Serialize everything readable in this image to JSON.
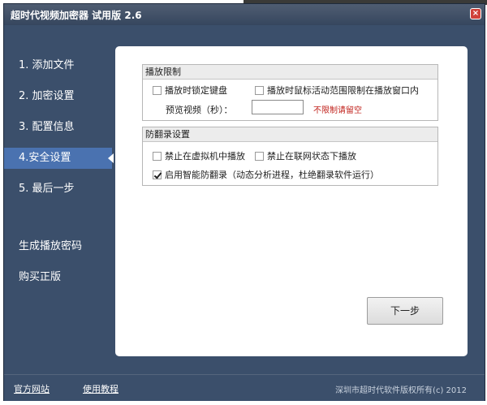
{
  "window": {
    "title": "超时代视频加密器 试用版 2.6",
    "close_icon_glyph": "×"
  },
  "nav": {
    "items": [
      {
        "label": "1. 添加文件",
        "active": false
      },
      {
        "label": "2. 加密设置",
        "active": false
      },
      {
        "label": "3. 配置信息",
        "active": false
      },
      {
        "label": "4.安全设置",
        "active": true
      },
      {
        "label": "5. 最后一步",
        "active": false
      }
    ],
    "generate_password": "生成播放密码",
    "buy": "购买正版"
  },
  "playback_limit": {
    "header": "播放限制",
    "lock_keyboard": {
      "label": "播放时锁定键盘",
      "checked": false
    },
    "restrict_mouse": {
      "label": "播放时鼠标活动范围限制在播放窗口内",
      "checked": false
    },
    "preview_label": "预览视频（秒）：",
    "preview_value": "",
    "preview_hint": "不限制请留空"
  },
  "anti_record": {
    "header": "防翻录设置",
    "no_vm": {
      "label": "禁止在虚拟机中播放",
      "checked": false
    },
    "no_online": {
      "label": "禁止在联网状态下播放",
      "checked": false
    },
    "smart": {
      "label": "启用智能防翻录（动态分析进程，杜绝翻录软件运行）",
      "checked": true
    }
  },
  "next_button": "下一步",
  "footer": {
    "official_site": "官方网站",
    "tutorial": "使用教程",
    "copyright": "深圳市超时代软件版权所有(c) 2012"
  },
  "colors": {
    "window_bg": "#3b4f6b",
    "nav_active": "#4a72b0",
    "hint_red": "#c0211b"
  }
}
